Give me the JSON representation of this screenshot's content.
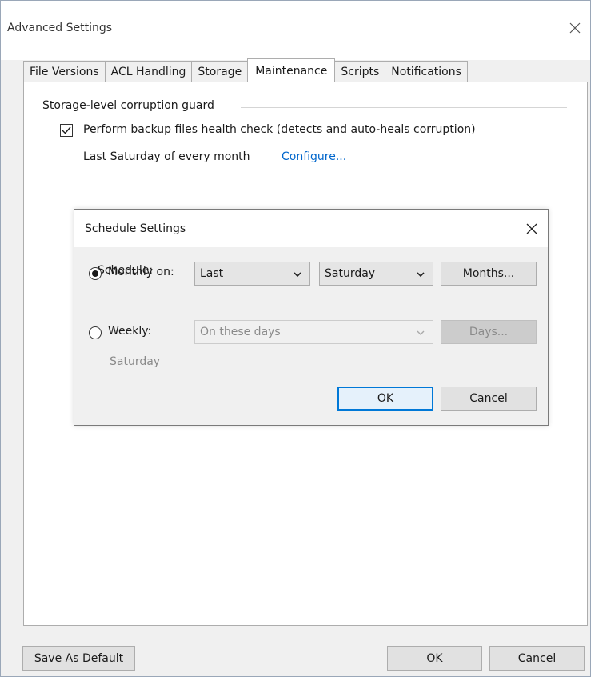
{
  "window": {
    "title": "Advanced Settings"
  },
  "tabs": [
    {
      "label": "File Versions"
    },
    {
      "label": "ACL Handling"
    },
    {
      "label": "Storage"
    },
    {
      "label": "Maintenance"
    },
    {
      "label": "Scripts"
    },
    {
      "label": "Notifications"
    }
  ],
  "active_tab": "Maintenance",
  "maintenance": {
    "group_label": "Storage-level corruption guard",
    "health_check_label": "Perform backup files health check (detects and auto-heals corruption)",
    "health_check_checked": true,
    "schedule_summary": "Last Saturday of every month",
    "configure_link": "Configure..."
  },
  "schedule_dialog": {
    "title": "Schedule Settings",
    "schedule_label": "Schedule:",
    "monthly": {
      "label": "Monthly on:",
      "selected": true,
      "week_value": "Last",
      "day_value": "Saturday",
      "months_button": "Months..."
    },
    "weekly": {
      "label": "Weekly:",
      "selected": false,
      "days_value": "On these days",
      "days_button": "Days...",
      "summary": "Saturday"
    },
    "ok_button": "OK",
    "cancel_button": "Cancel"
  },
  "footer": {
    "save_default_button": "Save As Default",
    "ok_button": "OK",
    "cancel_button": "Cancel"
  },
  "colors": {
    "link": "#0066cc",
    "default_button_border": "#0078d7",
    "window_bg": "#f0f0f0"
  }
}
